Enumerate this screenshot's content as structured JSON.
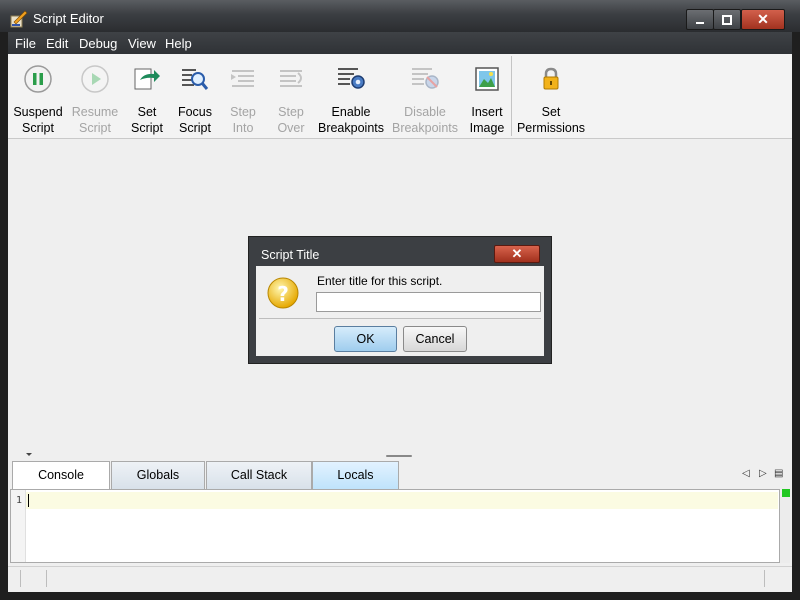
{
  "window": {
    "title": "Script Editor",
    "minimize": "▁",
    "maximize": "☐",
    "close": "✕"
  },
  "menu": [
    "File",
    "Edit",
    "Debug",
    "View",
    "Help"
  ],
  "toolbar": [
    {
      "line1": "Suspend",
      "line2": "Script",
      "icon": "pause-icon",
      "enabled": true
    },
    {
      "line1": "Resume",
      "line2": "Script",
      "icon": "play-icon",
      "enabled": false
    },
    {
      "line1": "Set",
      "line2": "Script",
      "icon": "set-script-icon",
      "enabled": true
    },
    {
      "line1": "Focus",
      "line2": "Script",
      "icon": "focus-script-icon",
      "enabled": true
    },
    {
      "line1": "Step",
      "line2": "Into",
      "icon": "step-into-icon",
      "enabled": false
    },
    {
      "line1": "Step",
      "line2": "Over",
      "icon": "step-over-icon",
      "enabled": false
    },
    {
      "line1": "Enable",
      "line2": "Breakpoints",
      "icon": "enable-breakpoints-icon",
      "enabled": true
    },
    {
      "line1": "Disable",
      "line2": "Breakpoints",
      "icon": "disable-breakpoints-icon",
      "enabled": false
    },
    {
      "line1": "Insert",
      "line2": "Image",
      "icon": "insert-image-icon",
      "enabled": true
    },
    {
      "line1": "Set",
      "line2": "Permissions",
      "icon": "lock-icon",
      "enabled": true
    }
  ],
  "dialog": {
    "title": "Script Title",
    "close": "✕",
    "message": "Enter title for this script.",
    "input_value": "",
    "icon": "question-icon",
    "ok_label": "OK",
    "cancel_label": "Cancel"
  },
  "tabs": [
    {
      "label": "Console",
      "active": true
    },
    {
      "label": "Globals",
      "active": false
    },
    {
      "label": "Call Stack",
      "active": false
    },
    {
      "label": "Locals",
      "active": false
    }
  ],
  "console": {
    "line_number": "1"
  },
  "colors": {
    "titlebar": "#3b3e42",
    "close": "#b8432e",
    "ok_button": "#aed6f1",
    "status_green": "#22c822"
  }
}
